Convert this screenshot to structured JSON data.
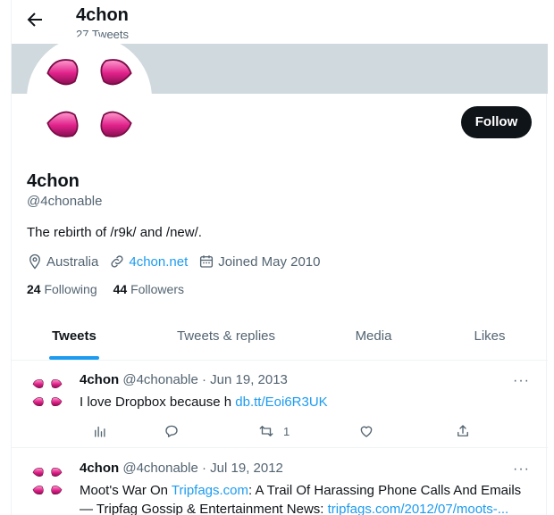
{
  "header": {
    "name": "4chon",
    "tweet_count": "27 Tweets"
  },
  "profile": {
    "name": "4chon",
    "handle": "@4chonable",
    "bio": "The rebirth of /r9k/ and /new/.",
    "location": "Australia",
    "website": "4chon.net",
    "joined": "Joined May 2010",
    "following_count": "24",
    "following_label": "Following",
    "followers_count": "44",
    "followers_label": "Followers",
    "follow_label": "Follow"
  },
  "tabs": [
    {
      "label": "Tweets",
      "active": true
    },
    {
      "label": "Tweets & replies"
    },
    {
      "label": "Media"
    },
    {
      "label": "Likes"
    }
  ],
  "tweets": [
    {
      "name": "4chon",
      "handle": "@4chonable",
      "date": "· Jun 19, 2013",
      "text": "I love Dropbox because h ",
      "link": "db.tt/Eoi6R3UK",
      "retweets": "1"
    },
    {
      "name": "4chon",
      "handle": "@4chonable",
      "date": "· Jul 19, 2012",
      "text_a": "Moot's War On ",
      "link_a": "Tripfags.com",
      "text_b": ": A Trail Of Harassing Phone Calls And Emails",
      "text_c": "— Tripfag Gossip & Entertainment News: ",
      "link_b": "tripfags.com/2012/07/moots-..."
    }
  ],
  "colors": {
    "accent": "#1d9bf0",
    "logo_pink": "#e0218a",
    "banner": "#cfd9de"
  }
}
